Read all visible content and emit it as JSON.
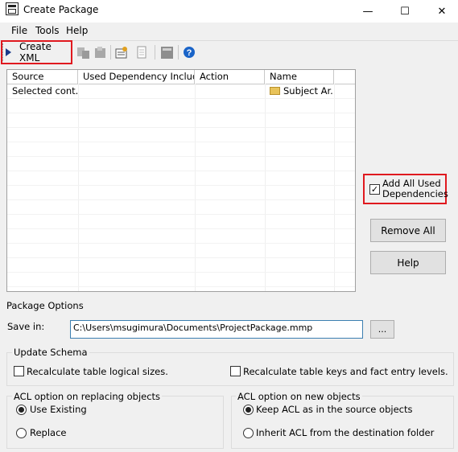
{
  "window": {
    "title": "Create Package",
    "minimize_glyph": "—",
    "maximize_glyph": "☐",
    "close_glyph": "✕"
  },
  "menu": {
    "file": "File",
    "tools": "Tools",
    "help": "Help"
  },
  "toolbar": {
    "create_xml_label": "Create XML"
  },
  "grid": {
    "columns": [
      "Source",
      "Used Dependency Included",
      "Action",
      "Name"
    ],
    "rows": [
      {
        "source": "Selected cont...",
        "used_dependency": "",
        "action": "",
        "name": "Subject Ar..."
      }
    ]
  },
  "side": {
    "add_all_used_dependencies_line1": "Add All Used",
    "add_all_used_dependencies_line2": "Dependencies",
    "add_all_checked": true,
    "remove_all_label": "Remove All",
    "help_label": "Help"
  },
  "package_options": {
    "heading": "Package Options",
    "save_in_label": "Save in:",
    "save_in_value": "C:\\Users\\msugimura\\Documents\\ProjectPackage.mmp",
    "browse_label": "..."
  },
  "update_schema": {
    "heading": "Update Schema",
    "recalc_logical_sizes": "Recalculate table logical sizes.",
    "recalc_keys": "Recalculate table keys and fact entry levels."
  },
  "acl_replacing": {
    "heading": "ACL option on replacing objects",
    "use_existing": "Use Existing",
    "replace": "Replace",
    "selected": "use_existing"
  },
  "acl_new": {
    "heading": "ACL option on new objects",
    "keep_acl": "Keep ACL as in the source objects",
    "inherit_acl": "Inherit ACL from the destination folder",
    "selected": "keep_acl"
  },
  "colors": {
    "highlight": "#e0191f",
    "help_icon": "#1a64c8"
  }
}
